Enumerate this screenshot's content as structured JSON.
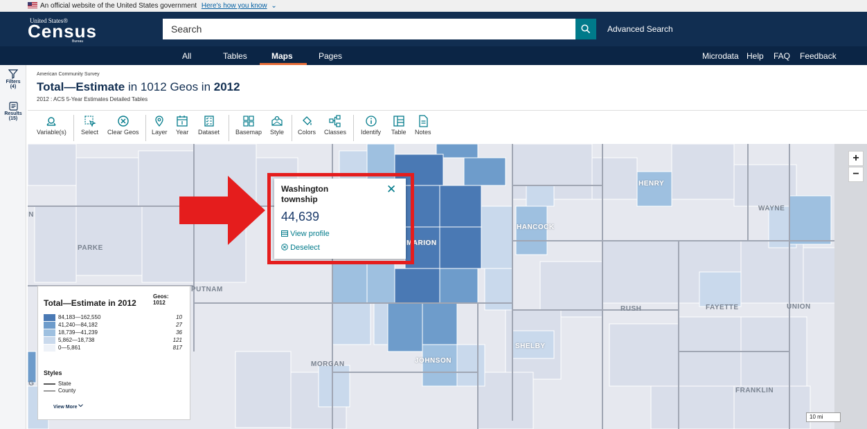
{
  "gov_banner": {
    "text": "An official website of the United States government",
    "link": "Here's how you know"
  },
  "header": {
    "logo_small": "United States®",
    "logo_big": "Census",
    "logo_bureau": "Bureau",
    "search_placeholder": "Search",
    "advanced_search": "Advanced Search"
  },
  "nav": {
    "tabs": [
      "All",
      "Tables",
      "Maps",
      "Pages"
    ],
    "active_tab": "Maps",
    "right_links": [
      "Microdata",
      "Help",
      "FAQ",
      "Feedback"
    ]
  },
  "rail": {
    "filters_label": "Filters",
    "filters_count": "(4)",
    "results_label": "Results",
    "results_count": "(15)"
  },
  "page": {
    "survey": "American Community Survey",
    "title_bold_1": "Total—Estimate",
    "title_mid": " in 1012 Geos in ",
    "title_bold_2": "2012",
    "subtitle": "2012 : ACS 5-Year Estimates Detailed Tables"
  },
  "toolbar": {
    "variables": "Variable(s)",
    "select": "Select",
    "clear_geos": "Clear Geos",
    "layer": "Layer",
    "year": "Year",
    "dataset": "Dataset",
    "basemap": "Basemap",
    "style": "Style",
    "colors": "Colors",
    "classes": "Classes",
    "identify": "Identify",
    "table": "Table",
    "notes": "Notes"
  },
  "map": {
    "counties": [
      "PARKE",
      "PUTNAM",
      "MARION",
      "HANCOCK",
      "HENRY",
      "WAYNE",
      "RUSH",
      "FAYETTE",
      "UNION",
      "SHELBY",
      "JOHNSON",
      "MORGAN",
      "FRANKLIN"
    ],
    "edge_labels": [
      "IN",
      "IG"
    ],
    "zoom_in": "+",
    "zoom_out": "−",
    "scale": "10 mi",
    "colors": {
      "class1": "#4a79b4",
      "class2": "#6e9ccb",
      "class3": "#9ec0e0",
      "class4": "#c9d9ec",
      "class5": "#e7ecf4",
      "highlight": "#e51d1d",
      "accent": "#007a8a"
    }
  },
  "popup": {
    "name": "Washington township",
    "value": "44,639",
    "view_profile": "View profile",
    "deselect": "Deselect"
  },
  "legend": {
    "title": "Total—Estimate in 2012",
    "geos_label": "Geos:",
    "geos_count": "1012",
    "classes": [
      {
        "range": "84,183—162,550",
        "count": "10"
      },
      {
        "range": "41,240—84,182",
        "count": "27"
      },
      {
        "range": "18,739—41,239",
        "count": "36"
      },
      {
        "range": "5,862—18,738",
        "count": "121"
      },
      {
        "range": "0—5,861",
        "count": "817"
      }
    ],
    "styles_label": "Styles",
    "style_state": "State",
    "style_county": "County",
    "view_more": "View More"
  }
}
